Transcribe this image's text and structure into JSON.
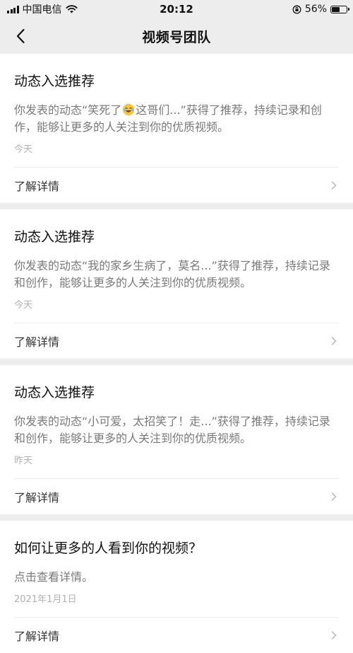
{
  "status_bar": {
    "carrier": "中国电信",
    "time": "20:12",
    "battery": "56%",
    "battery_level": 0.56
  },
  "nav": {
    "title": "视频号团队",
    "back_icon": "chevron-left-icon"
  },
  "cards": [
    {
      "title": "动态入选推荐",
      "desc_before": "你发表的动态“笑死了",
      "desc_icon": "laughing-emoji-icon",
      "desc_after": "这哥们...”获得了推荐，持续记录和创作，能够让更多的人关注到你的优质视频。",
      "date": "今天",
      "link": "了解详情"
    },
    {
      "title": "动态入选推荐",
      "desc": "你发表的动态“我的家乡生病了，莫名...”获得了推荐，持续记录和创作，能够让更多的人关注到你的优质视频。",
      "date": "今天",
      "link": "了解详情"
    },
    {
      "title": "动态入选推荐",
      "desc": "你发表的动态“小可爱，太招笑了！走...”获得了推荐，持续记录和创作，能够让更多的人关注到你的优质视频。",
      "date": "昨天",
      "link": "了解详情"
    },
    {
      "title": "如何让更多的人看到你的视频？",
      "desc": "点击查看详情。",
      "date": "2021年1月1日",
      "link": "了解详情"
    }
  ],
  "colors": {
    "background": "#ededed",
    "card": "#ffffff",
    "secondary_text": "#7a7a7a",
    "date_text": "#b2b2b2"
  }
}
